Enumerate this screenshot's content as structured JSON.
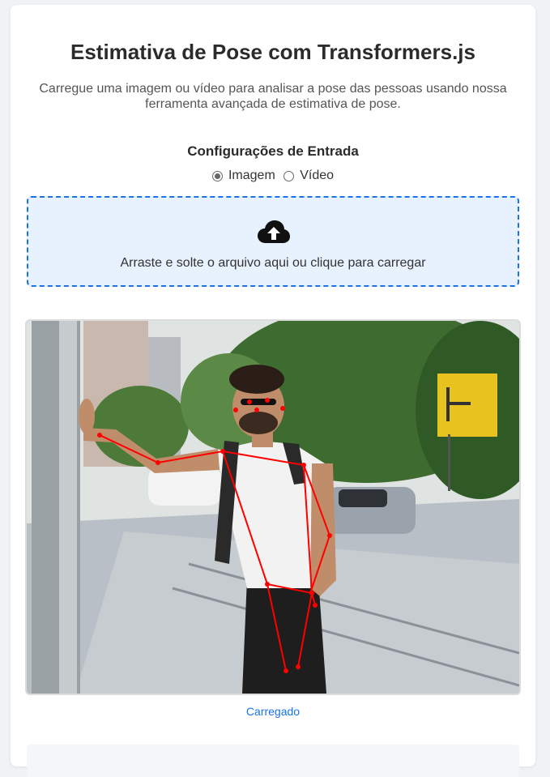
{
  "header": {
    "title": "Estimativa de Pose com Transformers.js",
    "subtitle": "Carregue uma imagem ou vídeo para analisar a pose das pessoas usando nossa ferramenta avançada de estimativa de pose."
  },
  "input_settings": {
    "title": "Configurações de Entrada",
    "options": [
      {
        "label": "Imagem",
        "checked": true
      },
      {
        "label": "Vídeo",
        "checked": false
      }
    ]
  },
  "dropzone": {
    "icon": "cloud-upload-icon",
    "text": "Arraste e solte o arquivo aqui ou clique para carregar"
  },
  "status": {
    "text": "Carregado"
  },
  "colors": {
    "accent": "#1a73e8",
    "dropzone_bg": "#e8f1fe",
    "skeleton": "#ff0000"
  }
}
